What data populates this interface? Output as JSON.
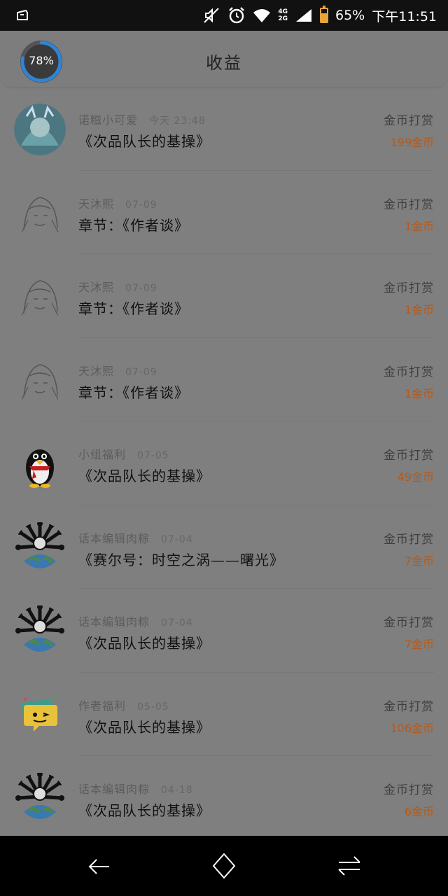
{
  "status_bar": {
    "network_top": "4G",
    "network_bottom": "2G",
    "battery_level": 0.65,
    "battery_text": "65%",
    "time": "下午11:51",
    "icons": [
      "app-icon",
      "mute-icon",
      "alarm-icon",
      "wifi-icon",
      "signal-icon",
      "battery-icon"
    ]
  },
  "header": {
    "title": "收益",
    "progress_label": "78%",
    "progress_value": 0.78,
    "accent_color": "#2f84d6"
  },
  "items": [
    {
      "name": "诺糍小可爱",
      "date": "今天 23:48",
      "title": "《次品队长的基操》",
      "type": "金币打赏",
      "amount": "199金币",
      "avatar": "anime-girl-blue"
    },
    {
      "name": "天沐熙",
      "date": "07-09",
      "title": "章节：《作者谈》",
      "type": "金币打赏",
      "amount": "1金币",
      "avatar": "anime-sketch"
    },
    {
      "name": "天沐熙",
      "date": "07-09",
      "title": "章节：《作者谈》",
      "type": "金币打赏",
      "amount": "1金币",
      "avatar": "anime-sketch"
    },
    {
      "name": "天沐熙",
      "date": "07-09",
      "title": "章节：《作者谈》",
      "type": "金币打赏",
      "amount": "1金币",
      "avatar": "anime-sketch"
    },
    {
      "name": "小组福利",
      "date": "07-05",
      "title": "《次品队长的基操》",
      "type": "金币打赏",
      "amount": "49金币",
      "avatar": "penguin"
    },
    {
      "name": "话本编辑肉粽",
      "date": "07-04",
      "title": "《赛尔号：时空之涡——曙光》",
      "type": "金币打赏",
      "amount": "7金币",
      "avatar": "globe-creature"
    },
    {
      "name": "话本编辑肉粽",
      "date": "07-04",
      "title": "《次品队长的基操》",
      "type": "金币打赏",
      "amount": "7金币",
      "avatar": "globe-creature"
    },
    {
      "name": "作者福利",
      "date": "05-05",
      "title": "《次品队长的基操》",
      "type": "金币打赏",
      "amount": "106金币",
      "avatar": "chat-bubble-face"
    },
    {
      "name": "话本编辑肉粽",
      "date": "04-18",
      "title": "《次品队长的基操》",
      "type": "金币打赏",
      "amount": "6金币",
      "avatar": "globe-creature"
    }
  ],
  "nav_bar": {
    "buttons": [
      "back-icon",
      "home-icon",
      "recents-icon"
    ]
  }
}
